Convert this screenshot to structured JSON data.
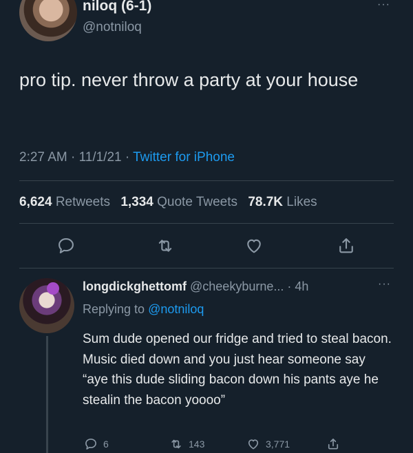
{
  "tweet": {
    "name": "niloq (6-1)",
    "handle": "@notniloq",
    "text": "pro tip. never throw a party at your house",
    "time_date": "2:27 AM · 11/1/21 · ",
    "source": "Twitter for iPhone",
    "stats": {
      "retweets_count": "6,624",
      "retweets_label": "Retweets",
      "quotes_count": "1,334",
      "quotes_label": "Quote Tweets",
      "likes_count": "78.7K",
      "likes_label": "Likes"
    },
    "more": "···"
  },
  "reply": {
    "name": "longdickghettomf",
    "handle_time": "@cheekyburne... · 4h",
    "more": "···",
    "replying_prefix": "Replying to ",
    "replying_to": "@notniloq",
    "text": "Sum dude opened our fridge and tried to steal bacon. Music died down and you just hear someone say “aye this dude sliding bacon down his pants aye he stealin the bacon yoooo”",
    "counts": {
      "replies": "6",
      "retweets": "143",
      "likes": "3,771"
    }
  },
  "icons": {
    "reply": "reply-icon",
    "retweet": "retweet-icon",
    "like": "heart-icon",
    "share": "share-icon"
  },
  "colors": {
    "background": "#15202b",
    "text": "#e7e9ea",
    "secondary": "#8b98a5",
    "accent": "#1d9bf0",
    "divider": "#38444d"
  }
}
